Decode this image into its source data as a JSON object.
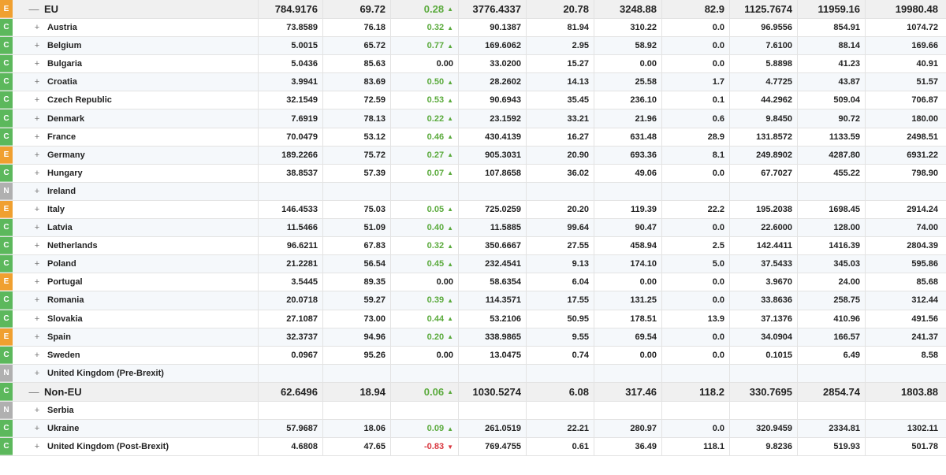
{
  "rows": [
    {
      "type": "group",
      "badge": "E",
      "toggle": "—",
      "name": "EU",
      "v1": "784.9176",
      "v2": "69.72",
      "chg": "0.28",
      "dir": "up",
      "v4": "3776.4337",
      "v5": "20.78",
      "v6": "3248.88",
      "v7": "82.9",
      "v8": "1125.7674",
      "v9": "11959.16",
      "v10": "19980.48"
    },
    {
      "type": "sub",
      "badge": "C",
      "toggle": "+",
      "name": "Austria",
      "v1": "73.8589",
      "v2": "76.18",
      "chg": "0.32",
      "dir": "up",
      "v4": "90.1387",
      "v5": "81.94",
      "v6": "310.22",
      "v7": "0.0",
      "v8": "96.9556",
      "v9": "854.91",
      "v10": "1074.72"
    },
    {
      "type": "sub",
      "badge": "C",
      "toggle": "+",
      "name": "Belgium",
      "v1": "5.0015",
      "v2": "65.72",
      "chg": "0.77",
      "dir": "up",
      "v4": "169.6062",
      "v5": "2.95",
      "v6": "58.92",
      "v7": "0.0",
      "v8": "7.6100",
      "v9": "88.14",
      "v10": "169.66"
    },
    {
      "type": "sub",
      "badge": "C",
      "toggle": "+",
      "name": "Bulgaria",
      "v1": "5.0436",
      "v2": "85.63",
      "chg": "0.00",
      "dir": "none",
      "v4": "33.0200",
      "v5": "15.27",
      "v6": "0.00",
      "v7": "0.0",
      "v8": "5.8898",
      "v9": "41.23",
      "v10": "40.91"
    },
    {
      "type": "sub",
      "badge": "C",
      "toggle": "+",
      "name": "Croatia",
      "v1": "3.9941",
      "v2": "83.69",
      "chg": "0.50",
      "dir": "up",
      "v4": "28.2602",
      "v5": "14.13",
      "v6": "25.58",
      "v7": "1.7",
      "v8": "4.7725",
      "v9": "43.87",
      "v10": "51.57"
    },
    {
      "type": "sub",
      "badge": "C",
      "toggle": "+",
      "name": "Czech Republic",
      "v1": "32.1549",
      "v2": "72.59",
      "chg": "0.53",
      "dir": "up",
      "v4": "90.6943",
      "v5": "35.45",
      "v6": "236.10",
      "v7": "0.1",
      "v8": "44.2962",
      "v9": "509.04",
      "v10": "706.87"
    },
    {
      "type": "sub",
      "badge": "C",
      "toggle": "+",
      "name": "Denmark",
      "v1": "7.6919",
      "v2": "78.13",
      "chg": "0.22",
      "dir": "up",
      "v4": "23.1592",
      "v5": "33.21",
      "v6": "21.96",
      "v7": "0.6",
      "v8": "9.8450",
      "v9": "90.72",
      "v10": "180.00"
    },
    {
      "type": "sub",
      "badge": "C",
      "toggle": "+",
      "name": "France",
      "v1": "70.0479",
      "v2": "53.12",
      "chg": "0.46",
      "dir": "up",
      "v4": "430.4139",
      "v5": "16.27",
      "v6": "631.48",
      "v7": "28.9",
      "v8": "131.8572",
      "v9": "1133.59",
      "v10": "2498.51"
    },
    {
      "type": "sub",
      "badge": "E",
      "toggle": "+",
      "name": "Germany",
      "v1": "189.2266",
      "v2": "75.72",
      "chg": "0.27",
      "dir": "up",
      "v4": "905.3031",
      "v5": "20.90",
      "v6": "693.36",
      "v7": "8.1",
      "v8": "249.8902",
      "v9": "4287.80",
      "v10": "6931.22"
    },
    {
      "type": "sub",
      "badge": "C",
      "toggle": "+",
      "name": "Hungary",
      "v1": "38.8537",
      "v2": "57.39",
      "chg": "0.07",
      "dir": "up",
      "v4": "107.8658",
      "v5": "36.02",
      "v6": "49.06",
      "v7": "0.0",
      "v8": "67.7027",
      "v9": "455.22",
      "v10": "798.90"
    },
    {
      "type": "sub",
      "badge": "N",
      "toggle": "+",
      "name": "Ireland",
      "v1": "",
      "v2": "",
      "chg": "",
      "dir": "none",
      "v4": "",
      "v5": "",
      "v6": "",
      "v7": "",
      "v8": "",
      "v9": "",
      "v10": ""
    },
    {
      "type": "sub",
      "badge": "E",
      "toggle": "+",
      "name": "Italy",
      "v1": "146.4533",
      "v2": "75.03",
      "chg": "0.05",
      "dir": "up",
      "v4": "725.0259",
      "v5": "20.20",
      "v6": "119.39",
      "v7": "22.2",
      "v8": "195.2038",
      "v9": "1698.45",
      "v10": "2914.24"
    },
    {
      "type": "sub",
      "badge": "C",
      "toggle": "+",
      "name": "Latvia",
      "v1": "11.5466",
      "v2": "51.09",
      "chg": "0.40",
      "dir": "up",
      "v4": "11.5885",
      "v5": "99.64",
      "v6": "90.47",
      "v7": "0.0",
      "v8": "22.6000",
      "v9": "128.00",
      "v10": "74.00"
    },
    {
      "type": "sub",
      "badge": "C",
      "toggle": "+",
      "name": "Netherlands",
      "v1": "96.6211",
      "v2": "67.83",
      "chg": "0.32",
      "dir": "up",
      "v4": "350.6667",
      "v5": "27.55",
      "v6": "458.94",
      "v7": "2.5",
      "v8": "142.4411",
      "v9": "1416.39",
      "v10": "2804.39"
    },
    {
      "type": "sub",
      "badge": "C",
      "toggle": "+",
      "name": "Poland",
      "v1": "21.2281",
      "v2": "56.54",
      "chg": "0.45",
      "dir": "up",
      "v4": "232.4541",
      "v5": "9.13",
      "v6": "174.10",
      "v7": "5.0",
      "v8": "37.5433",
      "v9": "345.03",
      "v10": "595.86"
    },
    {
      "type": "sub",
      "badge": "E",
      "toggle": "+",
      "name": "Portugal",
      "v1": "3.5445",
      "v2": "89.35",
      "chg": "0.00",
      "dir": "none",
      "v4": "58.6354",
      "v5": "6.04",
      "v6": "0.00",
      "v7": "0.0",
      "v8": "3.9670",
      "v9": "24.00",
      "v10": "85.68"
    },
    {
      "type": "sub",
      "badge": "C",
      "toggle": "+",
      "name": "Romania",
      "v1": "20.0718",
      "v2": "59.27",
      "chg": "0.39",
      "dir": "up",
      "v4": "114.3571",
      "v5": "17.55",
      "v6": "131.25",
      "v7": "0.0",
      "v8": "33.8636",
      "v9": "258.75",
      "v10": "312.44"
    },
    {
      "type": "sub",
      "badge": "C",
      "toggle": "+",
      "name": "Slovakia",
      "v1": "27.1087",
      "v2": "73.00",
      "chg": "0.44",
      "dir": "up",
      "v4": "53.2106",
      "v5": "50.95",
      "v6": "178.51",
      "v7": "13.9",
      "v8": "37.1376",
      "v9": "410.96",
      "v10": "491.56"
    },
    {
      "type": "sub",
      "badge": "E",
      "toggle": "+",
      "name": "Spain",
      "v1": "32.3737",
      "v2": "94.96",
      "chg": "0.20",
      "dir": "up",
      "v4": "338.9865",
      "v5": "9.55",
      "v6": "69.54",
      "v7": "0.0",
      "v8": "34.0904",
      "v9": "166.57",
      "v10": "241.37"
    },
    {
      "type": "sub",
      "badge": "C",
      "toggle": "+",
      "name": "Sweden",
      "v1": "0.0967",
      "v2": "95.26",
      "chg": "0.00",
      "dir": "none",
      "v4": "13.0475",
      "v5": "0.74",
      "v6": "0.00",
      "v7": "0.0",
      "v8": "0.1015",
      "v9": "6.49",
      "v10": "8.58"
    },
    {
      "type": "sub",
      "badge": "N",
      "toggle": "+",
      "name": "United Kingdom (Pre-Brexit)",
      "v1": "",
      "v2": "",
      "chg": "",
      "dir": "none",
      "v4": "",
      "v5": "",
      "v6": "",
      "v7": "",
      "v8": "",
      "v9": "",
      "v10": ""
    },
    {
      "type": "group",
      "badge": "C",
      "toggle": "—",
      "name": "Non-EU",
      "v1": "62.6496",
      "v2": "18.94",
      "chg": "0.06",
      "dir": "up",
      "v4": "1030.5274",
      "v5": "6.08",
      "v6": "317.46",
      "v7": "118.2",
      "v8": "330.7695",
      "v9": "2854.74",
      "v10": "1803.88"
    },
    {
      "type": "sub",
      "badge": "N",
      "toggle": "+",
      "name": "Serbia",
      "v1": "",
      "v2": "",
      "chg": "",
      "dir": "none",
      "v4": "",
      "v5": "",
      "v6": "",
      "v7": "",
      "v8": "",
      "v9": "",
      "v10": ""
    },
    {
      "type": "sub",
      "badge": "C",
      "toggle": "+",
      "name": "Ukraine",
      "v1": "57.9687",
      "v2": "18.06",
      "chg": "0.09",
      "dir": "up",
      "v4": "261.0519",
      "v5": "22.21",
      "v6": "280.97",
      "v7": "0.0",
      "v8": "320.9459",
      "v9": "2334.81",
      "v10": "1302.11"
    },
    {
      "type": "sub",
      "badge": "C",
      "toggle": "+",
      "name": "United Kingdom (Post-Brexit)",
      "v1": "4.6808",
      "v2": "47.65",
      "chg": "-0.83",
      "dir": "down",
      "v4": "769.4755",
      "v5": "0.61",
      "v6": "36.49",
      "v7": "118.1",
      "v8": "9.8236",
      "v9": "519.93",
      "v10": "501.78"
    }
  ]
}
